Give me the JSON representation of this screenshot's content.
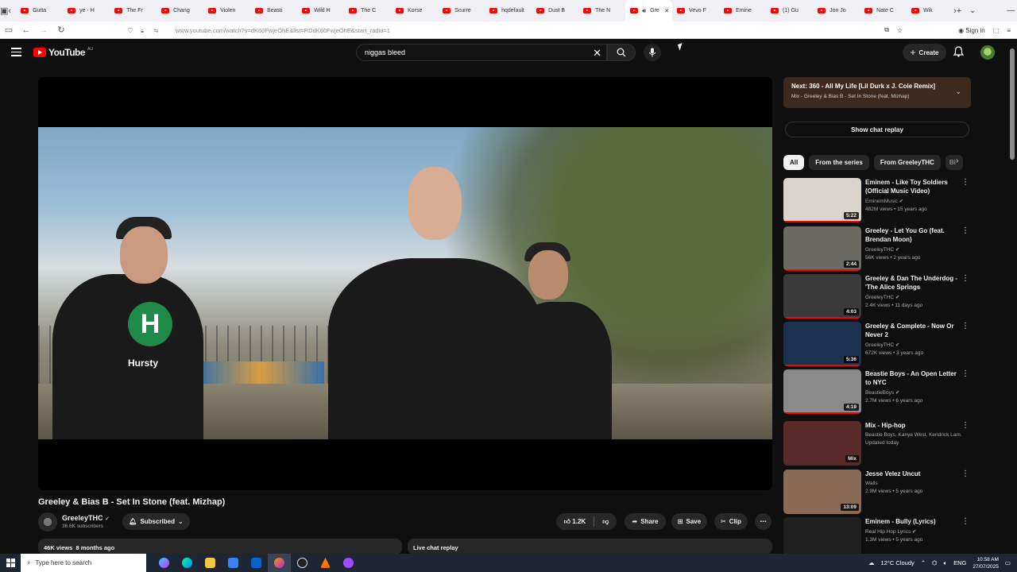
{
  "browser": {
    "tabs": [
      {
        "label": "Gutta"
      },
      {
        "label": "ye - H"
      },
      {
        "label": "The Fr"
      },
      {
        "label": "Chang"
      },
      {
        "label": "Violen"
      },
      {
        "label": "Beasti"
      },
      {
        "label": "Wild H"
      },
      {
        "label": "The C"
      },
      {
        "label": "Korse"
      },
      {
        "label": "Scurre"
      },
      {
        "label": "hqdefault"
      },
      {
        "label": "Dust B"
      },
      {
        "label": "The N"
      },
      {
        "label": "Gre"
      },
      {
        "label": "Vevo F"
      },
      {
        "label": "Emine"
      },
      {
        "label": "(1) Gu"
      },
      {
        "label": "Jon Jo"
      },
      {
        "label": "Nate C"
      },
      {
        "label": "Wik"
      }
    ],
    "first_tab_fragment": "ne",
    "active_tab_index": 13,
    "url": "www.youtube.com/watch?v=dK60FwjeOhE&list=RDdK60FwjeOhE&start_radio=1",
    "signin_label": "Sign in"
  },
  "header": {
    "logo_text": "YouTube",
    "country": "AU",
    "search_value": "niggas bleed",
    "create_label": "Create"
  },
  "video": {
    "title": "Greeley & Bias B - Set In Stone (feat. Mizhap)",
    "channel": "GreeleyTHC",
    "subscribers": "36.6K subscribers",
    "subscribed_label": "Subscribed",
    "likes": "1.2K",
    "share_label": "Share",
    "save_label": "Save",
    "clip_label": "Clip",
    "shirt_text": "Hursty",
    "views": "46K views",
    "age": "8 months ago",
    "live_chat": "Live chat replay"
  },
  "sidebar": {
    "next_title": "Next: 360 - All My Life [Lil Durk x J. Cole Remix]",
    "next_sub": "Mix - Greeley & Bias B - Set In Stone (feat. Mizhap)",
    "chat_button": "Show chat replay",
    "chips": [
      "All",
      "From the series",
      "From GreeleyTHC",
      "Bi"
    ],
    "recs": [
      {
        "title": "Eminem - Like Toy Soldiers (Official Music Video)",
        "channel": "EminemMusic",
        "meta": "482M views • 15 years ago",
        "duration": "5:22",
        "color": "#d9d4cc"
      },
      {
        "title": "Greeley - Let You Go (feat. Brendan Moon)",
        "channel": "GreeleyTHC",
        "meta": "56K views • 2 years ago",
        "duration": "2:44",
        "color": "#6b6a64"
      },
      {
        "title": "Greeley & Dan The Underdog - 'The Alice Springs Connection'...",
        "channel": "GreeleyTHC",
        "meta": "2.4K views • 11 days ago",
        "duration": "4:03",
        "color": "#3a3a3a"
      },
      {
        "title": "Greeley & Complete - Now Or Never 2",
        "channel": "GreeleyTHC",
        "meta": "672K views • 3 years ago",
        "duration": "5:36",
        "color": "#1d3150"
      },
      {
        "title": "Beastie Boys - An Open Letter to NYC",
        "channel": "BeastieBoys",
        "meta": "2.7M views • 6 years ago",
        "duration": "4:19",
        "color": "#8a8a8a"
      },
      {
        "title": "Mix - Hip-hop",
        "channel": "Beastie Boys, Kanye West, Kendrick Lam...",
        "meta": "Updated today",
        "duration": "Mix",
        "color": "#5a2a2a"
      },
      {
        "title": "Jesse Velez Uncut",
        "channel": "Walls",
        "meta": "2.9M views • 5 years ago",
        "duration": "13:09",
        "color": "#8a6a55"
      },
      {
        "title": "Eminem - Bully (Lyrics)",
        "channel": "Real Hip Hop Lyrics",
        "meta": "1.3M views • 5 years ago",
        "duration": "",
        "color": "#202020"
      }
    ]
  },
  "taskbar": {
    "search_placeholder": "Type here to search",
    "weather": "12°C Cloudy",
    "lang": "ENG",
    "time": "10:58 AM",
    "date": "27/07/2025"
  }
}
